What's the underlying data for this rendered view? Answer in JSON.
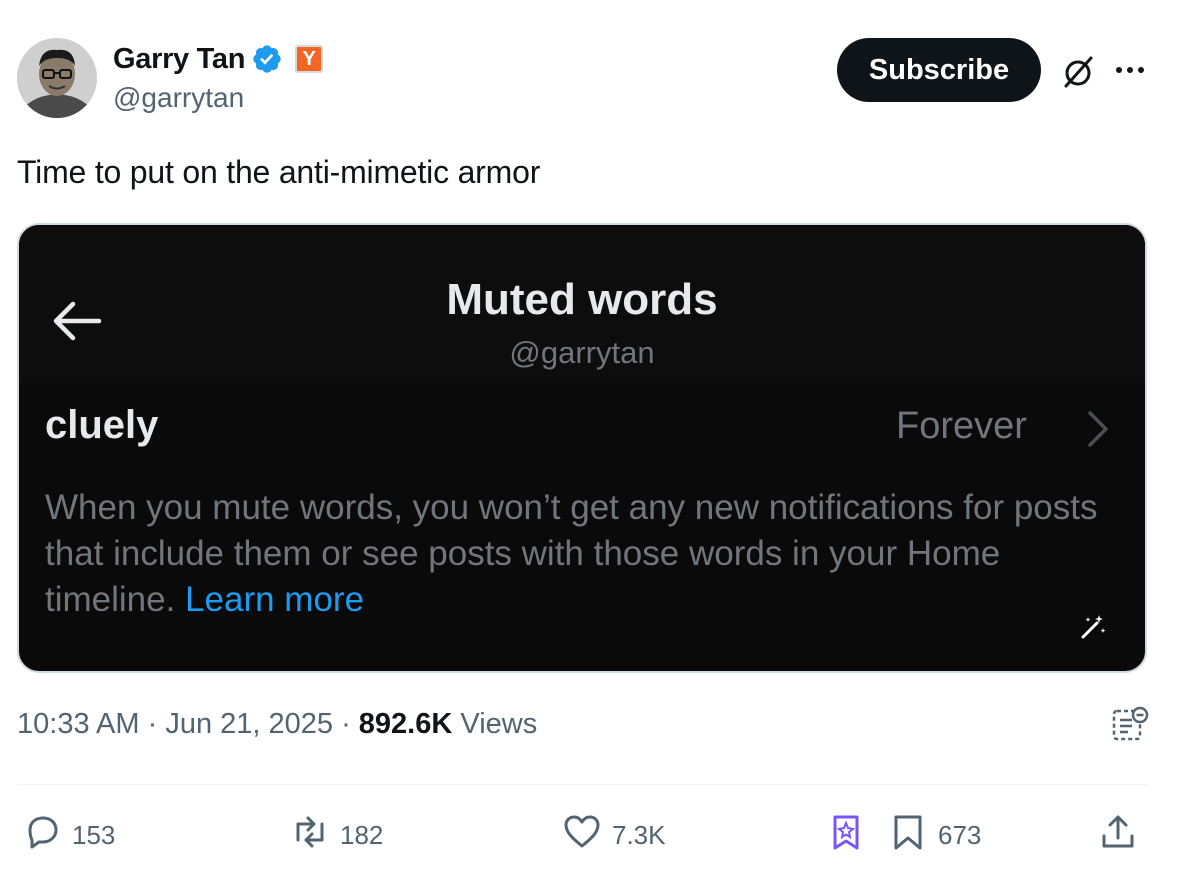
{
  "author": {
    "name": "Garry Tan",
    "handle": "@garrytan",
    "badge_text": "Y"
  },
  "header": {
    "subscribe_label": "Subscribe"
  },
  "tweet": {
    "text": "Time to put on the anti-mimetic armor"
  },
  "media": {
    "title": "Muted words",
    "handle": "@garrytan",
    "word": "cluely",
    "duration": "Forever",
    "description": "When you mute words, you won’t get any new notifications for posts that include them or see posts with those words in your Home timeline.",
    "learn_more": "Learn more"
  },
  "meta": {
    "time": "10:33 AM",
    "separator": " · ",
    "date": "Jun 21, 2025",
    "views_count": "892.6K",
    "views_label": "Views"
  },
  "actions": {
    "replies": "153",
    "reposts": "182",
    "likes": "7.3K",
    "bookmarks": "673"
  },
  "colors": {
    "verified": "#1d9bf0",
    "yc_badge": "#f26522",
    "link": "#1d9bf0",
    "premium": "#7856ff"
  }
}
